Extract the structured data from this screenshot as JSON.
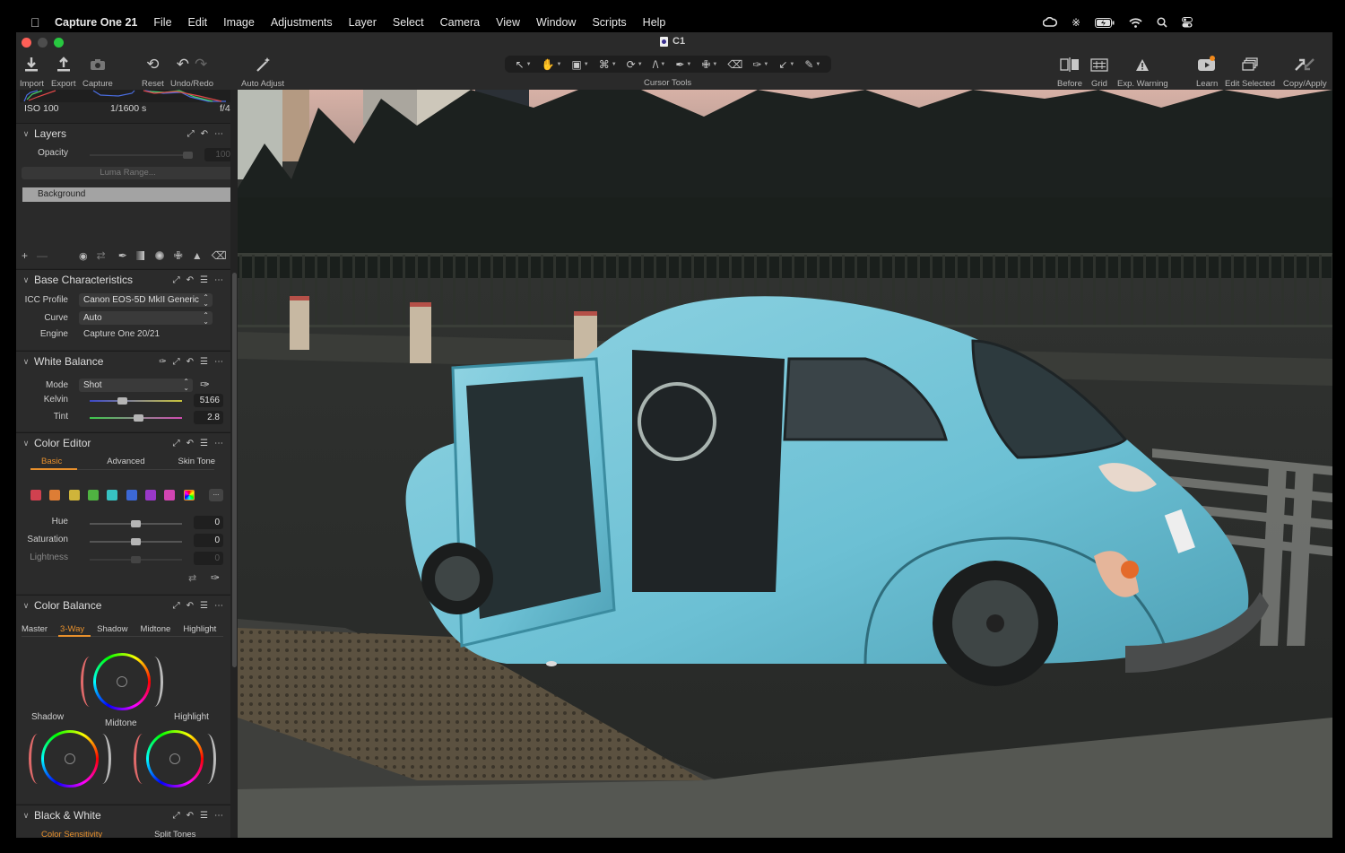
{
  "menubar": {
    "apple_icon": "apple-logo-icon",
    "app_name": "Capture One 21",
    "items": [
      "File",
      "Edit",
      "Image",
      "Adjustments",
      "Layer",
      "Select",
      "Camera",
      "View",
      "Window",
      "Scripts",
      "Help"
    ],
    "status_icons": [
      "creative-cloud-icon",
      "bluetooth-icon",
      "battery-charging-icon",
      "wifi-icon",
      "spotlight-search-icon",
      "control-center-icon"
    ]
  },
  "window": {
    "title": "C1"
  },
  "toolbar": {
    "left": [
      {
        "label": "Import",
        "icon": "import-icon"
      },
      {
        "label": "Export",
        "icon": "export-icon"
      },
      {
        "label": "Capture",
        "icon": "camera-icon"
      },
      {
        "label": "Reset",
        "icon": "reset-icon"
      },
      {
        "label": "Undo/Redo",
        "icon": "undo-redo-icon"
      },
      {
        "label": "Auto Adjust",
        "icon": "magic-wand-icon"
      }
    ],
    "cursor_tools_label": "Cursor Tools",
    "cursor_tools": [
      "select-icon",
      "pan-hand-icon",
      "viewer-icon",
      "crop-icon",
      "rotate-icon",
      "keystone-icon",
      "brush-icon",
      "heal-icon",
      "eraser-icon",
      "picker-icon",
      "annotate-icon",
      "pencil-icon"
    ],
    "right": [
      {
        "label": "Before",
        "icon": "before-after-icon"
      },
      {
        "label": "Grid",
        "icon": "grid-icon"
      },
      {
        "label": "Exp. Warning",
        "icon": "warning-icon"
      },
      {
        "label": "Learn",
        "icon": "play-video-icon"
      },
      {
        "label": "Edit Selected",
        "icon": "edit-selected-icon"
      },
      {
        "label": "Copy/Apply",
        "icon": "copy-apply-icon"
      }
    ]
  },
  "histogram": {
    "iso": "ISO 100",
    "shutter": "1/1600 s",
    "aperture": "f/4"
  },
  "layers": {
    "title": "Layers",
    "opacity_label": "Opacity",
    "opacity_value": "100",
    "luma_range_label": "Luma Range...",
    "layer_items": [
      "Background"
    ],
    "footer_icons": [
      "add-layer-icon",
      "remove-layer-icon",
      "visibility-eye-icon",
      "swap-icon",
      "brush-icon",
      "linear-gradient-icon",
      "radial-gradient-icon",
      "heal-icon",
      "clone-stamp-icon",
      "eraser-icon"
    ]
  },
  "base_characteristics": {
    "title": "Base Characteristics",
    "icc_label": "ICC Profile",
    "icc_value": "Canon EOS-5D MkII Generic",
    "curve_label": "Curve",
    "curve_value": "Auto",
    "engine_label": "Engine",
    "engine_value": "Capture One 20/21"
  },
  "white_balance": {
    "title": "White Balance",
    "mode_label": "Mode",
    "mode_value": "Shot",
    "kelvin_label": "Kelvin",
    "kelvin_value": "5166",
    "kelvin_position": 0.35,
    "tint_label": "Tint",
    "tint_value": "2.8",
    "tint_position": 0.52
  },
  "color_editor": {
    "title": "Color Editor",
    "tabs": [
      "Basic",
      "Advanced",
      "Skin Tone"
    ],
    "active_tab": "Basic",
    "swatches": [
      "#d0414f",
      "#dd7d35",
      "#cfb43a",
      "#4fb341",
      "#37c3c3",
      "#3c68d6",
      "#9a38c8",
      "#d245b2"
    ],
    "more_label": "...",
    "hue_label": "Hue",
    "hue_value": "0",
    "saturation_label": "Saturation",
    "saturation_value": "0",
    "lightness_label": "Lightness",
    "lightness_value": "0"
  },
  "color_balance": {
    "title": "Color Balance",
    "tabs": [
      "Master",
      "3-Way",
      "Shadow",
      "Midtone",
      "Highlight"
    ],
    "active_tab": "3-Way",
    "wheels": [
      "Shadow",
      "Midtone",
      "Highlight"
    ]
  },
  "black_white": {
    "title": "Black & White",
    "tabs": [
      "Color Sensitivity",
      "Split Tones"
    ],
    "active_tab": "Color Sensitivity"
  },
  "colors": {
    "accent": "#e8902c",
    "panel": "#2b2b2b",
    "car": "#6fc4d6"
  }
}
